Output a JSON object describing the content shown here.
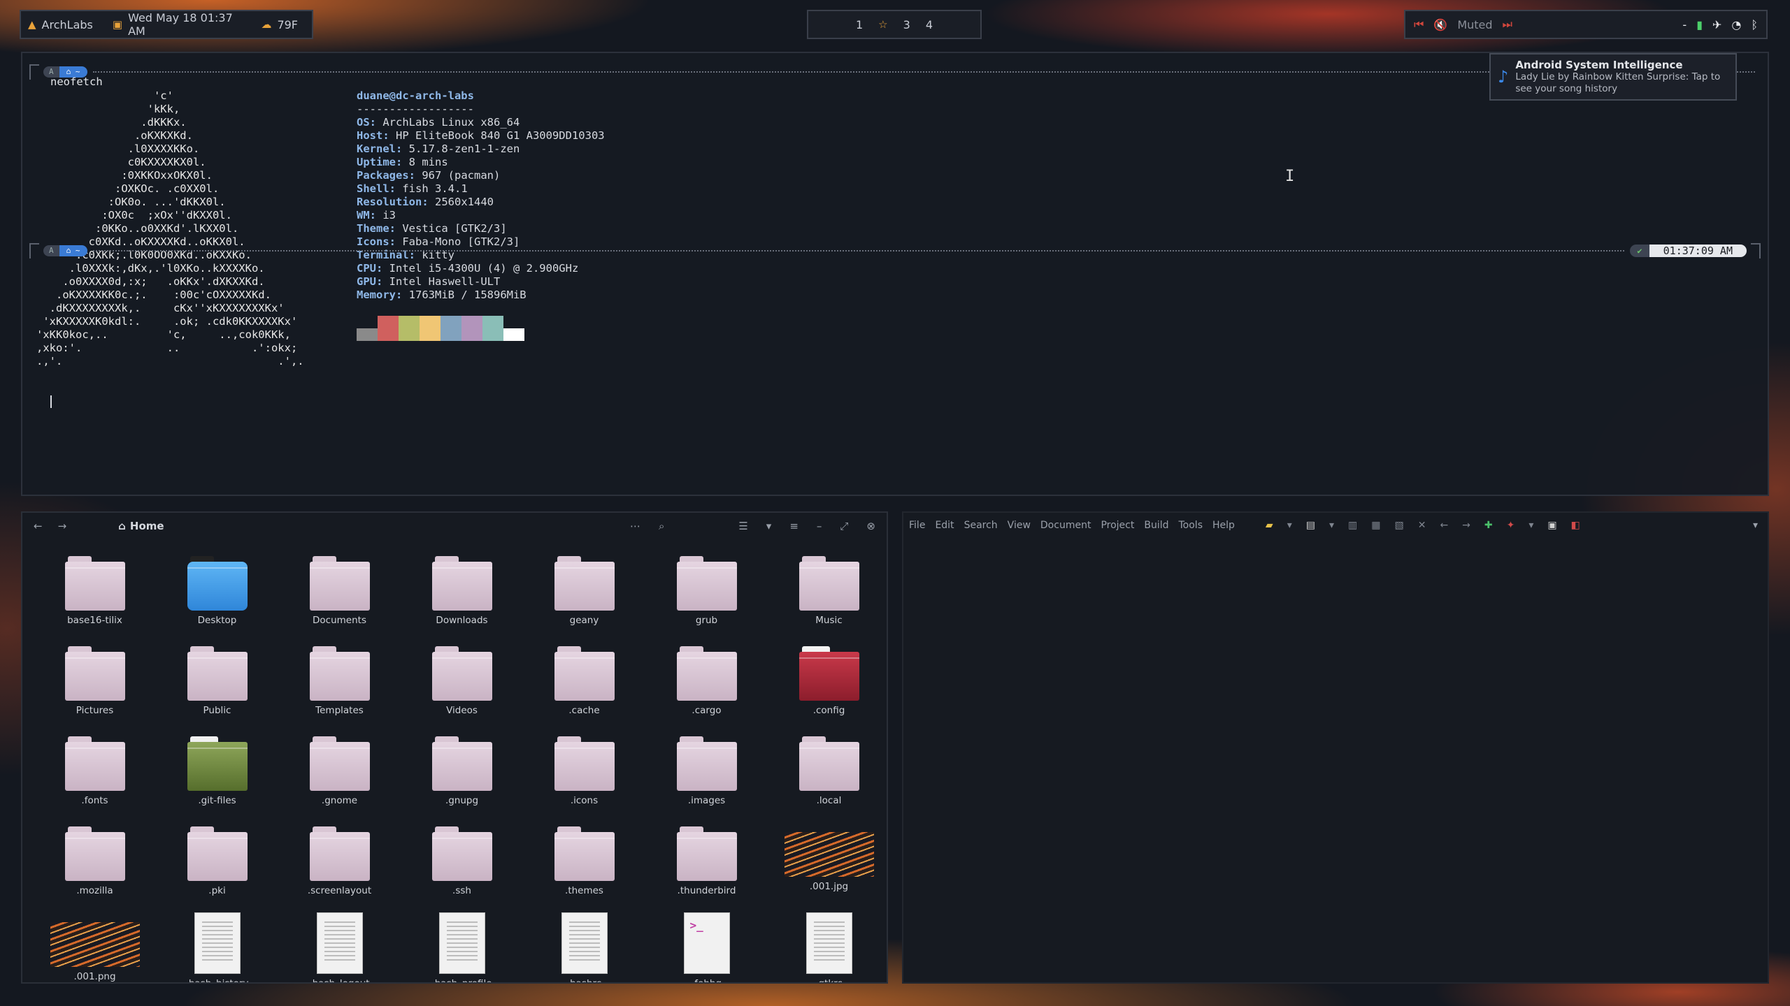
{
  "topbar": {
    "distro": "ArchLabs",
    "datetime": "Wed May 18 01:37 AM",
    "weather": "79F",
    "workspaces": [
      "1",
      "☆",
      "3",
      "4"
    ],
    "media_status": "Muted",
    "tray_dash": "-"
  },
  "notification": {
    "title": "Android System Intelligence",
    "body": "Lady Lie by Rainbow Kitten Surprise: Tap to see your song history"
  },
  "terminal": {
    "prompt_seg1": "A",
    "prompt_seg2": "⌂ ~",
    "command": "neofetch",
    "ascii_art": "                  'c'\n                 'kKk,\n                .dKKKx.\n               .oKXKXKd.\n              .l0XXXXKKo.\n              c0KXXXXKX0l.\n             :0XKKOxxOKX0l.\n            :OXKOc. .c0XX0l.\n           :OK0o. ...'dKKX0l.\n          :OX0c  ;xOx''dKXX0l.\n         :0KKo..o0XXKd'.lKXX0l.\n        c0XKd..oKXXXXKd..oKKX0l.\n      .c0XKk;.l0K0OO0XKd..oKXXKo.\n     .l0XXXk:,dKx,.'l0XKo..kXXXXKo.\n    .o0XXXX0d,:x;   .oKKx'.dXKXXKd.\n   .oKXXXXKK0c.;.    :00c'cOXXXXXKd.\n  .dKXXXXXXXXk,.     cKx''xKXXXXXXXKx'\n 'xKXXXXXK0kdl:.     .ok; .cdk0KKXXXXKx'\n'xKK0koc,..         'c,     ..,cok0KKk,\n,xko:'.             ..           .':okx;\n.,'.                                 .',.",
    "user_host": "duane@dc-arch-labs",
    "separator": "------------------",
    "info": [
      {
        "key": "OS",
        "value": "ArchLabs Linux x86_64"
      },
      {
        "key": "Host",
        "value": "HP EliteBook 840 G1 A3009DD10303"
      },
      {
        "key": "Kernel",
        "value": "5.17.8-zen1-1-zen"
      },
      {
        "key": "Uptime",
        "value": "8 mins"
      },
      {
        "key": "Packages",
        "value": "967 (pacman)"
      },
      {
        "key": "Shell",
        "value": "fish 3.4.1"
      },
      {
        "key": "Resolution",
        "value": "2560x1440"
      },
      {
        "key": "WM",
        "value": "i3"
      },
      {
        "key": "Theme",
        "value": "Vestica [GTK2/3]"
      },
      {
        "key": "Icons",
        "value": "Faba-Mono [GTK2/3]"
      },
      {
        "key": "Terminal",
        "value": "kitty"
      },
      {
        "key": "CPU",
        "value": "Intel i5-4300U (4) @ 2.900GHz"
      },
      {
        "key": "GPU",
        "value": "Intel Haswell-ULT"
      },
      {
        "key": "Memory",
        "value": "1763MiB / 15896MiB"
      }
    ],
    "palette": [
      "#8a8a8a",
      "#d0605e",
      "#b5bd68",
      "#f0c674",
      "#81a2be",
      "#b294bb",
      "#8abeb7",
      "#ffffff"
    ],
    "status_ok": "✔",
    "time": "01:37:09 AM"
  },
  "file_manager": {
    "location": "Home",
    "items": [
      {
        "name": "base16-tilix",
        "kind": "folder"
      },
      {
        "name": "Desktop",
        "kind": "folder-blue"
      },
      {
        "name": "Documents",
        "kind": "folder"
      },
      {
        "name": "Downloads",
        "kind": "folder"
      },
      {
        "name": "geany",
        "kind": "folder"
      },
      {
        "name": "grub",
        "kind": "folder"
      },
      {
        "name": "Music",
        "kind": "folder"
      },
      {
        "name": "Pictures",
        "kind": "folder"
      },
      {
        "name": "Public",
        "kind": "folder"
      },
      {
        "name": "Templates",
        "kind": "folder"
      },
      {
        "name": "Videos",
        "kind": "folder"
      },
      {
        "name": ".cache",
        "kind": "folder"
      },
      {
        "name": ".cargo",
        "kind": "folder"
      },
      {
        "name": ".config",
        "kind": "folder-red"
      },
      {
        "name": ".fonts",
        "kind": "folder"
      },
      {
        "name": ".git-files",
        "kind": "folder-green"
      },
      {
        "name": ".gnome",
        "kind": "folder"
      },
      {
        "name": ".gnupg",
        "kind": "folder"
      },
      {
        "name": ".icons",
        "kind": "folder"
      },
      {
        "name": ".images",
        "kind": "folder"
      },
      {
        "name": ".local",
        "kind": "folder"
      },
      {
        "name": ".mozilla",
        "kind": "folder"
      },
      {
        "name": ".pki",
        "kind": "folder"
      },
      {
        "name": ".screenlayout",
        "kind": "folder"
      },
      {
        "name": ".ssh",
        "kind": "folder"
      },
      {
        "name": ".themes",
        "kind": "folder"
      },
      {
        "name": ".thunderbird",
        "kind": "folder"
      },
      {
        "name": ".001.jpg",
        "kind": "image"
      },
      {
        "name": ".001.png",
        "kind": "image"
      },
      {
        "name": ".bash_history",
        "kind": "doc"
      },
      {
        "name": ".bash_logout",
        "kind": "doc"
      },
      {
        "name": ".bash_profile",
        "kind": "doc"
      },
      {
        "name": ".bashrc",
        "kind": "doc"
      },
      {
        "name": ".fehbg",
        "kind": "doc-term"
      },
      {
        "name": ".gtkrc",
        "kind": "doc"
      }
    ]
  },
  "geany": {
    "menu": [
      "File",
      "Edit",
      "Search",
      "View",
      "Document",
      "Project",
      "Build",
      "Tools",
      "Help"
    ]
  }
}
